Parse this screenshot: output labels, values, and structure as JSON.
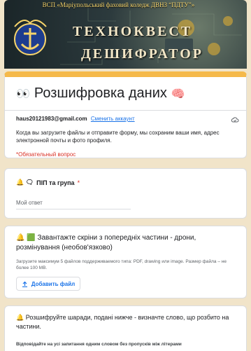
{
  "banner": {
    "college": "ВСП «Маріупольський фаховий коледж ДВНЗ “ПДТУ”»",
    "title_line1": "ТЕХНОКВЕСТ",
    "title_line2": "ДЕШИФРАТОР"
  },
  "header": {
    "title_emoji": "👀",
    "title": "Розшифровка даних",
    "title_emoji2": "🧠",
    "account_email": "haus20121983@gmail.com",
    "switch_account": "Сменить аккаунт",
    "note": "Когда вы загрузите файлы и отправите форму, мы сохраним ваши имя, адрес электронной почты и фото профиля.",
    "required_note": "*Обязательный вопрос"
  },
  "question1": {
    "emoji": "🔔 🗨",
    "label": "ПІП та група",
    "required_mark": "*",
    "answer_placeholder": "Мой ответ"
  },
  "question2": {
    "label": "🔔 🟩 Завантажте скріни з попередніх частини - дрони, розмінування (необов'язково)",
    "help": "Загрузите максимум 5 файлов поддерживаемого типа: PDF, drawing или image. Размер файла – не более 100 MB.",
    "upload_label": "Добавить файл"
  },
  "question3": {
    "label": "🔔 Розшифруйте шаради, подані нижче - визначте слово, що розбито на частини.",
    "description": "Відповідайте на усі запитання одним словом без пропусків між літерами"
  },
  "colors": {
    "accent": "#f5b94a",
    "link": "#1a73e8",
    "required": "#d93025",
    "page_bg": "#f1e4c9"
  }
}
